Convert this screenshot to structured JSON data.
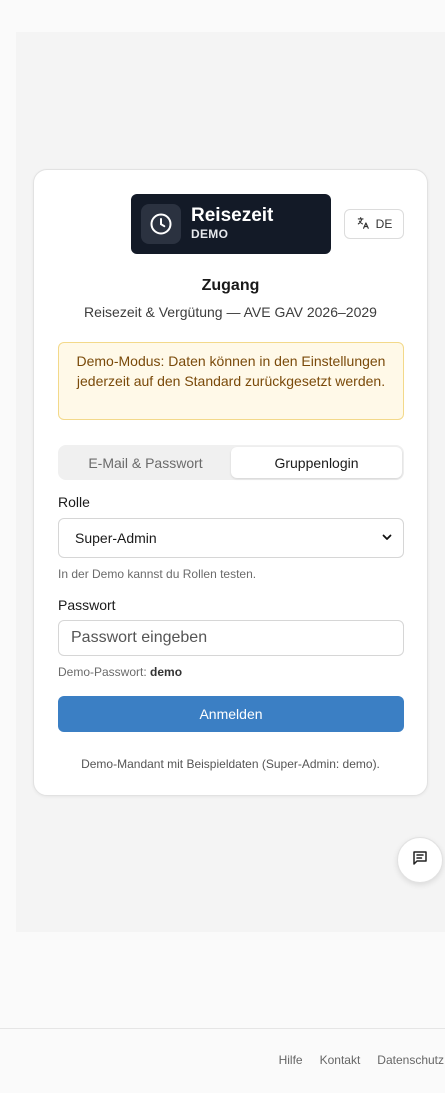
{
  "brand": {
    "name": "Reisezeit",
    "badge": "DEMO",
    "icon": "clock-icon",
    "bg_color": "#131a27"
  },
  "language": {
    "icon": "translate-icon",
    "label": "DE"
  },
  "heading": {
    "title": "Zugang",
    "subtitle": "Reisezeit & Vergütung — AVE GAV 2026–2029"
  },
  "notice": {
    "text": "Demo-Modus: Daten können in den Einstellungen jederzeit auf den Standard zurückgesetzt werden."
  },
  "tabs": [
    {
      "label": "E-Mail & Passwort",
      "active": false
    },
    {
      "label": "Gruppenlogin",
      "active": true
    }
  ],
  "form": {
    "role_label": "Rolle",
    "role_value": "Super-Admin",
    "role_hint": "In der Demo kannst du Rollen testen.",
    "password_label": "Passwort",
    "password_placeholder": "Passwort eingeben",
    "password_hint_prefix": "Demo-Passwort: ",
    "password_hint_value": "demo",
    "submit_label": "Anmelden"
  },
  "footnote": "Demo-Mandant mit Beispieldaten (Super-Admin: demo).",
  "chat_button": {
    "icon": "message-icon"
  },
  "footer": {
    "links": [
      "Hilfe",
      "Kontakt",
      "Datenschutz"
    ]
  },
  "colors": {
    "accent": "#3b7fc4",
    "notice_bg": "#fff9e8",
    "notice_border": "#f3d98a",
    "notice_text": "#7a4a0a"
  }
}
